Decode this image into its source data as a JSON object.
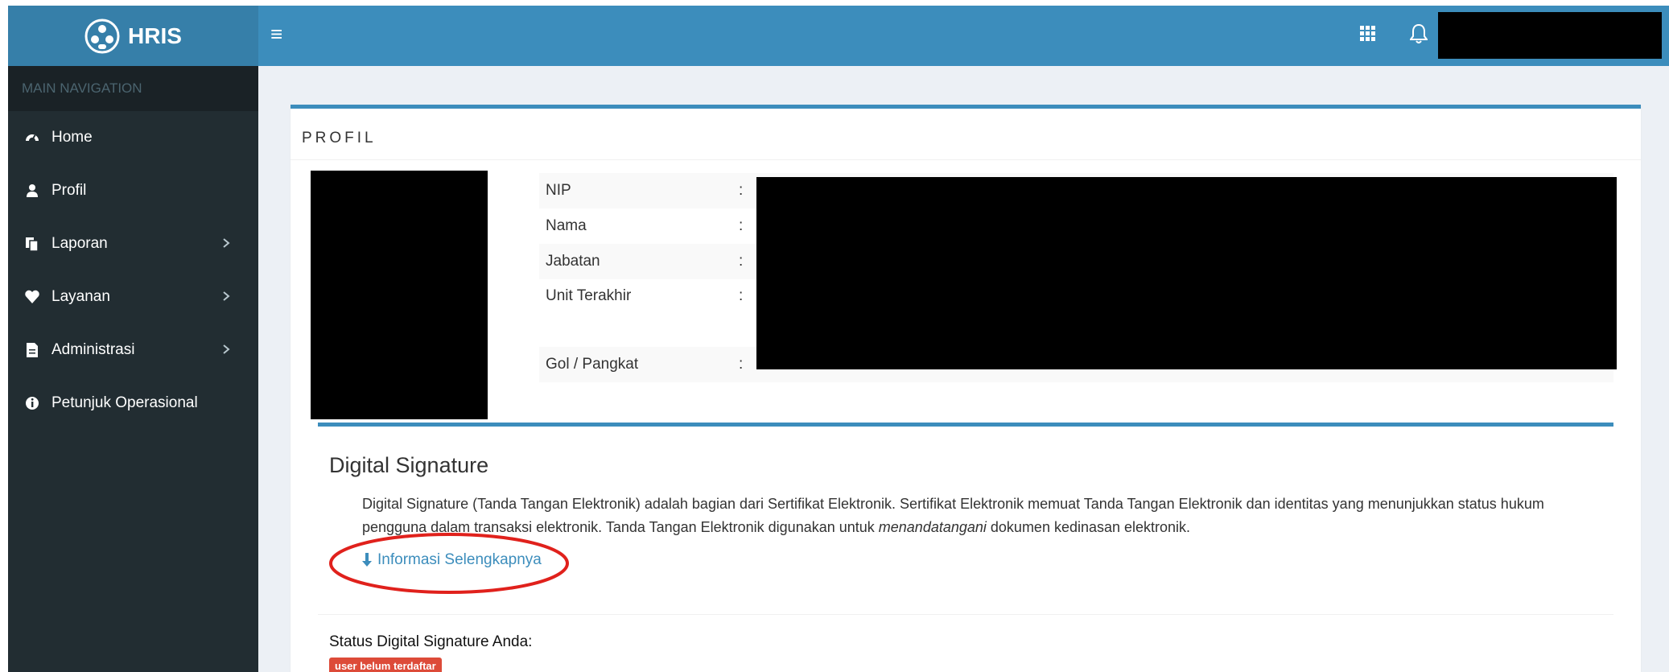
{
  "app": {
    "title": "HRIS"
  },
  "colors": {
    "header": "#3c8dbc",
    "logo_bg": "#367fa9",
    "sidebar": "#222d32",
    "badge_danger": "#dd4b39",
    "annotation": "#e0211c"
  },
  "sidebar": {
    "header": "MAIN NAVIGATION",
    "items": [
      {
        "label": "Home",
        "icon": "dashboard-icon"
      },
      {
        "label": "Profil",
        "icon": "user-icon"
      },
      {
        "label": "Laporan",
        "icon": "copy-icon",
        "has_submenu": true
      },
      {
        "label": "Layanan",
        "icon": "heart-icon",
        "has_submenu": true
      },
      {
        "label": "Administrasi",
        "icon": "file-icon",
        "has_submenu": true
      },
      {
        "label": "Petunjuk Operasional",
        "icon": "info-circle-icon"
      }
    ]
  },
  "profile": {
    "title": "PROFIL",
    "fields": [
      {
        "label": "NIP",
        "colon": ":"
      },
      {
        "label": "Nama",
        "colon": ":"
      },
      {
        "label": "Jabatan",
        "colon": ":"
      },
      {
        "label": "Unit Terakhir",
        "colon": ":"
      },
      {
        "label": "Gol / Pangkat",
        "colon": ":"
      }
    ]
  },
  "digital_signature": {
    "title": "Digital Signature",
    "description_part1": "Digital Signature (Tanda Tangan Elektronik) adalah bagian dari Sertifikat Elektronik. Sertifikat Elektronik memuat Tanda Tangan Elektronik dan identitas yang menunjukkan status hukum pengguna dalam transaksi elektronik. Tanda Tangan Elektronik digunakan untuk ",
    "description_emphasis": "menandatangani",
    "description_part2": " dokumen kedinasan elektronik.",
    "more_link": "Informasi Selengkapnya",
    "status_label": "Status Digital Signature Anda:",
    "status_badge": "user belum terdaftar"
  }
}
